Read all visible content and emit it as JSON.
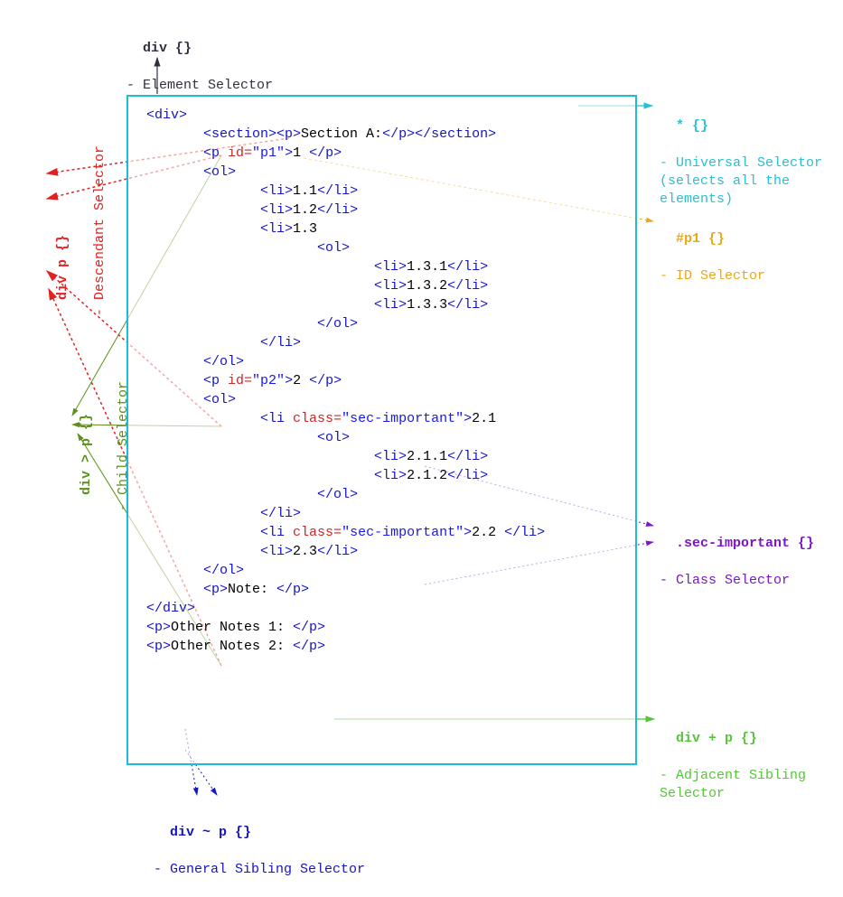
{
  "labels": {
    "element": {
      "title": "div {}",
      "subtitle": "- Element Selector"
    },
    "universal": {
      "title": "* {}",
      "subtitle": "- Universal Selector\n(selects all the\nelements)"
    },
    "id": {
      "title": "#p1 {}",
      "subtitle": "- ID Selector"
    },
    "class": {
      "title": ".sec-important {}",
      "subtitle": "- Class Selector"
    },
    "adjacent": {
      "title": "div + p {}",
      "subtitle": "- Adjacent Sibling\nSelector"
    },
    "general": {
      "title": "div ~ p {}",
      "subtitle": "- General Sibling Selector"
    },
    "child": {
      "title": "div > p {}",
      "subtitle": "- Child Selector"
    },
    "descendant": {
      "title": "div p {}",
      "subtitle": "- Descendant Selector"
    }
  },
  "code": {
    "l01": "<div>",
    "l02t1": "<section><p>",
    "l02x": "Section A:",
    "l02t2": "</p></section>",
    "l03": "<p",
    "l03a": " id=",
    "l03s": "\"p1\"",
    "l03c": ">",
    "l03x": "1 ",
    "l03e": "</p>",
    "l04": "<ol>",
    "l05": "<li>",
    "l05x": "1.1",
    "l05e": "</li>",
    "l06": "<li>",
    "l06x": "1.2",
    "l06e": "</li>",
    "l07": "<li>",
    "l07x": "1.3",
    "l08": "<ol>",
    "l09": "<li>",
    "l09x": "1.3.1",
    "l09e": "</li>",
    "l10": "<li>",
    "l10x": "1.3.2",
    "l10e": "</li>",
    "l11": "<li>",
    "l11x": "1.3.3",
    "l11e": "</li>",
    "l12": "</ol>",
    "l13": "</li>",
    "l14": "</ol>",
    "blank": "",
    "l16": "<p",
    "l16a": " id=",
    "l16s": "\"p2\"",
    "l16c": ">",
    "l16x": "2 ",
    "l16e": "</p>",
    "l17": "<ol>",
    "l18": "<li",
    "l18a": " class=",
    "l18s": "\"sec-important\"",
    "l18c": ">",
    "l18x": "2.1",
    "l19": "<ol>",
    "l20": "<li>",
    "l20x": "2.1.1",
    "l20e": "</li>",
    "l21": "<li>",
    "l21x": "2.1.2",
    "l21e": "</li>",
    "l22": "</ol>",
    "l23": "</li>",
    "l24": "<li",
    "l24a": " class=",
    "l24s": "\"sec-important\"",
    "l24c": ">",
    "l24x": "2.2 ",
    "l24e": "</li>",
    "l25": "<li>",
    "l25x": "2.3",
    "l25e": "</li>",
    "l26": "</ol>",
    "l28": "<p>",
    "l28x": "Note: ",
    "l28e": "</p>",
    "l29": "</div>",
    "l30": "<p>",
    "l30x": "Other Notes 1: ",
    "l30e": "</p>",
    "l31": "<p>",
    "l31x": "Other Notes 2: ",
    "l31e": "</p>"
  }
}
